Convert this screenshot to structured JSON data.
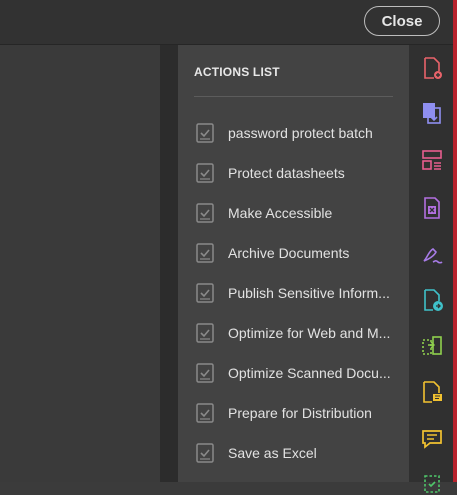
{
  "header": {
    "close_label": "Close"
  },
  "actions_panel": {
    "title": "ACTIONS LIST",
    "items": [
      {
        "label": "password protect batch"
      },
      {
        "label": "Protect datasheets"
      },
      {
        "label": "Make Accessible"
      },
      {
        "label": "Archive Documents"
      },
      {
        "label": "Publish Sensitive Inform..."
      },
      {
        "label": "Optimize for Web and M..."
      },
      {
        "label": "Optimize Scanned Docu..."
      },
      {
        "label": "Prepare for Distribution"
      },
      {
        "label": "Save as Excel"
      }
    ],
    "item_icon": "action-checklist-icon"
  },
  "tool_rail": {
    "tools": [
      {
        "icon": "create-pdf-icon",
        "color": "#e8636a"
      },
      {
        "icon": "combine-files-icon",
        "color": "#8f8ff0"
      },
      {
        "icon": "organize-pages-icon",
        "color": "#e85d8e"
      },
      {
        "icon": "export-pdf-icon",
        "color": "#b36fe0"
      },
      {
        "icon": "fill-sign-icon",
        "color": "#a77be6"
      },
      {
        "icon": "send-for-review-icon",
        "color": "#3fc1c9"
      },
      {
        "icon": "compare-files-icon",
        "color": "#8fd04d"
      },
      {
        "icon": "comment-file-icon",
        "color": "#f2c230"
      },
      {
        "icon": "comment-icon",
        "color": "#f2c230"
      },
      {
        "icon": "scan-ocr-icon",
        "color": "#4fc76a"
      }
    ]
  },
  "colors": {
    "accent_edge": "#b8232d",
    "panel_bg": "#434343",
    "rail_bg": "#303030"
  }
}
